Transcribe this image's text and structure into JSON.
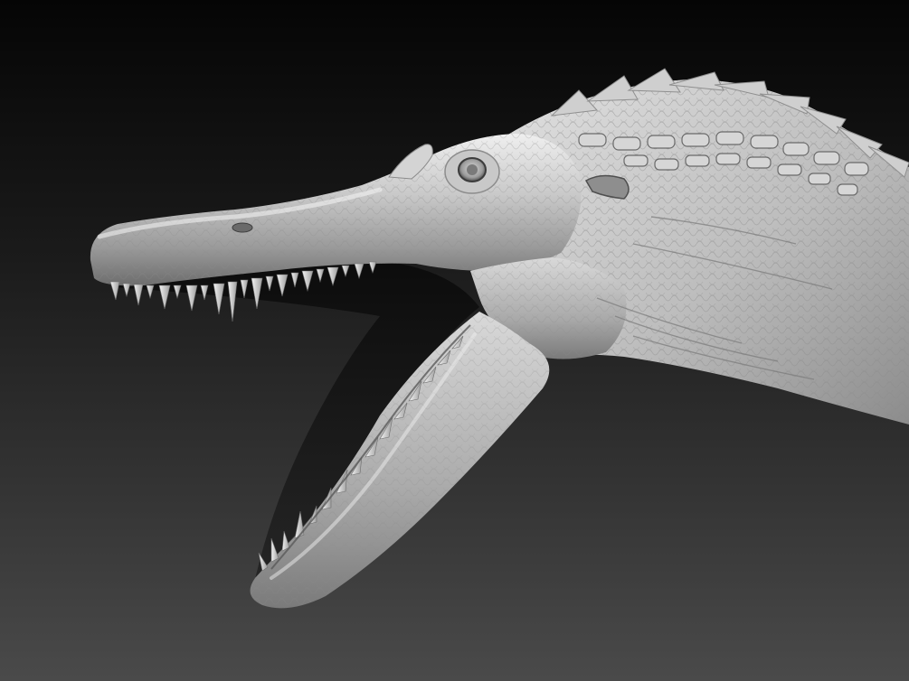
{
  "canvas": {
    "background_top": "#050505",
    "background_bottom": "#4a4a4a",
    "surface_color": "#b7b7b7",
    "highlight_color": "#efefef",
    "shadow_color": "#1a1a1a"
  },
  "subject": {
    "model_kind": "spinosaur-head-clay-render",
    "mouth_state": "open",
    "view": "right-profile"
  }
}
